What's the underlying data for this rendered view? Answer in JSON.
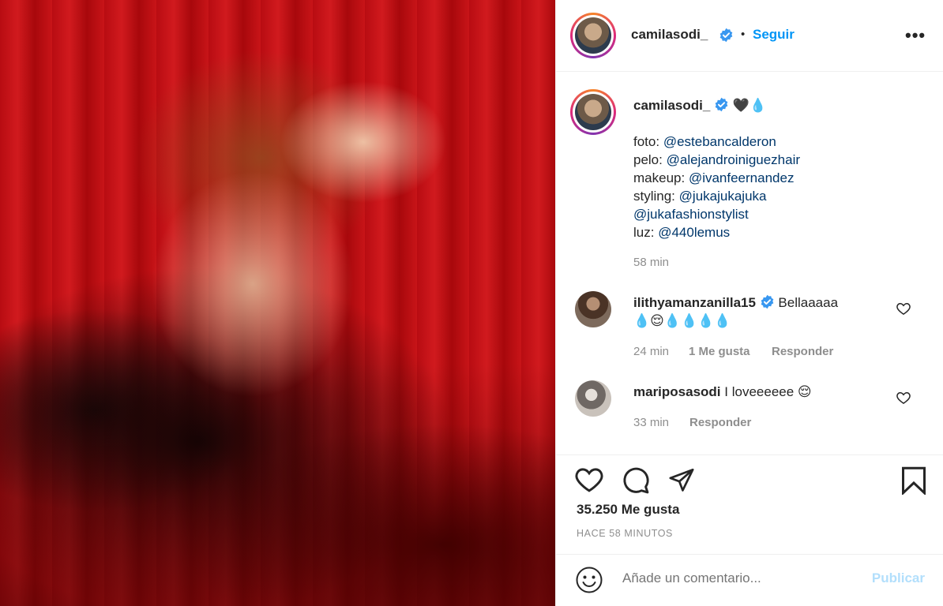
{
  "post": {
    "username": "camilasodi_",
    "follow_label": "Seguir",
    "dot": "•",
    "more_label": "•••"
  },
  "caption": {
    "username": "camilasodi_",
    "emoji": "🖤💧",
    "lines": [
      {
        "label": "foto:",
        "mention": "@estebancalderon"
      },
      {
        "label": "pelo:",
        "mention": "@alejandroiniguezhair"
      },
      {
        "label": "makeup:",
        "mention": "@ivanfeernandez"
      },
      {
        "label": "styling:",
        "mention": "@jukajukajuka"
      },
      {
        "label": "",
        "mention": "@jukafashionstylist"
      },
      {
        "label": "luz:",
        "mention": "@440lemus"
      }
    ],
    "time": "58 min"
  },
  "comments": [
    {
      "username": "ilithyamanzanilla15",
      "text": "Bellaaaaa",
      "emoji_line": "💧😌💧💧💧💧",
      "time": "24 min",
      "likes": "1 Me gusta",
      "reply": "Responder"
    },
    {
      "username": "mariposasodi",
      "text": "I loveeeeee 😌",
      "time": "33 min",
      "reply": "Responder"
    }
  ],
  "actions": {
    "likes": "35.250 Me gusta",
    "timeago": "HACE 58 MINUTOS"
  },
  "add_comment": {
    "placeholder": "Añade un comentario...",
    "publish": "Publicar"
  },
  "colors": {
    "link": "#0095f6",
    "mention": "#00376b",
    "muted": "#8e8e8e",
    "verified": "#3897f0"
  }
}
